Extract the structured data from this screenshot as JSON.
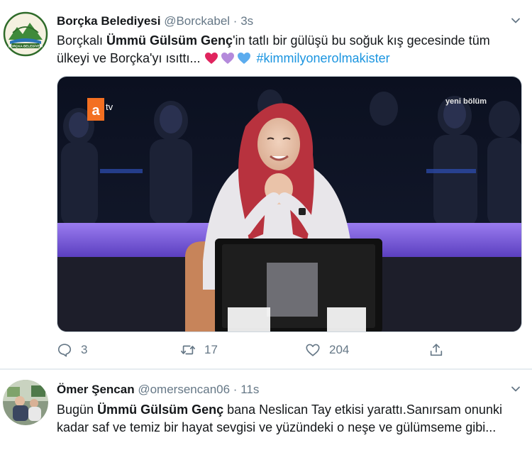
{
  "tweets": [
    {
      "author_name": "Borçka Belediyesi",
      "handle": "@Borckabel",
      "separator": "·",
      "time": "3s",
      "text": {
        "pre": "Borçkalı ",
        "bold": "Ümmü Gülsüm Genç",
        "post": "'in tatlı bir gülüşü bu soğuk kış gecesinde tüm ülkeyi ve Borçka'yı ısıttı... ",
        "hashtag": "#kimmilyonerolmakister"
      },
      "hearts": [
        "#e0245e",
        "#b48adb",
        "#5cacee"
      ],
      "avatar_text": "BORÇKA BELEDİYESİ",
      "media": {
        "channel_logo_text": "a",
        "channel_suffix": "tv",
        "overlay_label": "yeni bölüm"
      },
      "actions": {
        "replies": "3",
        "retweets": "17",
        "likes": "204"
      }
    },
    {
      "author_name": "Ömer Şencan",
      "handle": "@omersencan06",
      "separator": "·",
      "time": "11s",
      "text": {
        "pre": "Bugün ",
        "bold": "Ümmü Gülsüm Genç",
        "post": " bana Neslican Tay etkisi yarattı.Sanırsam onunki kadar saf ve temiz bir hayat sevgisi ve yüzündeki o neşe ve gülümseme gibi..."
      }
    }
  ],
  "colors": {
    "name": "#14171a",
    "secondary": "#657786",
    "hashtag": "#1b95e0",
    "atv_orange": "#f36f21",
    "studio_purple": "#7b57d8",
    "hijab": "#b8323e"
  },
  "icons": [
    "reply-icon",
    "retweet-icon",
    "like-icon",
    "share-icon",
    "chevron-down-icon"
  ]
}
